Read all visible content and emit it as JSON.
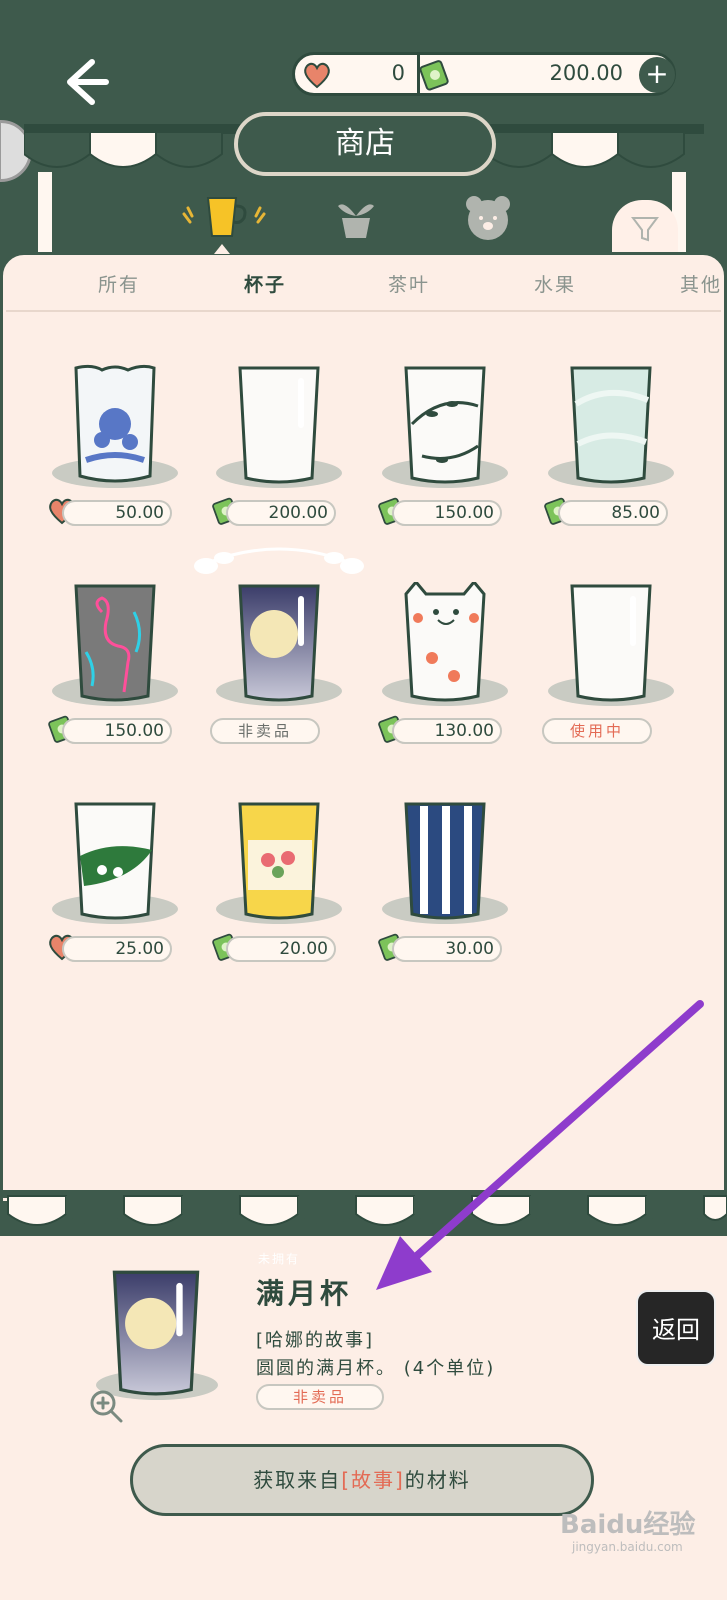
{
  "header": {
    "back_icon": "back-arrow-icon",
    "hearts": "0",
    "cash": "200.00",
    "title": "商店",
    "add_icon": "plus-icon"
  },
  "categories": {
    "icons": [
      "cup-icon",
      "plant-icon",
      "bear-icon"
    ],
    "filter_icon": "filter-icon",
    "tabs": [
      "所有",
      "杯子",
      "茶叶",
      "水果",
      "其他"
    ],
    "active_tab": "杯子"
  },
  "items": [
    {
      "price": "50.00",
      "currency": "heart"
    },
    {
      "price": "200.00",
      "currency": "cash"
    },
    {
      "price": "150.00",
      "currency": "cash"
    },
    {
      "price": "85.00",
      "currency": "cash"
    },
    {
      "price": "150.00",
      "currency": "cash"
    },
    {
      "status": "非卖品"
    },
    {
      "price": "130.00",
      "currency": "cash"
    },
    {
      "status": "使用中"
    },
    {
      "price": "25.00",
      "currency": "heart"
    },
    {
      "price": "20.00",
      "currency": "cash"
    },
    {
      "price": "30.00",
      "currency": "cash"
    }
  ],
  "detail": {
    "tag": "未拥有",
    "name": "满月杯",
    "story": "[哈娜的故事]",
    "description": "圆圆的满月杯。 (4个单位)",
    "status": "非卖品",
    "action_pre": "获取来自",
    "action_hl": "[故事]",
    "action_post": "的材料",
    "zoom_icon": "zoom-in-icon"
  },
  "floating": {
    "return_label": "返回"
  },
  "watermark": {
    "text": "Baidu经验",
    "sub": "jingyan.baidu.com"
  },
  "colors": {
    "dark_green": "#3e5a4c",
    "cream": "#fdeee6",
    "accent": "#e36b55",
    "arrow": "#8e3ccc"
  }
}
